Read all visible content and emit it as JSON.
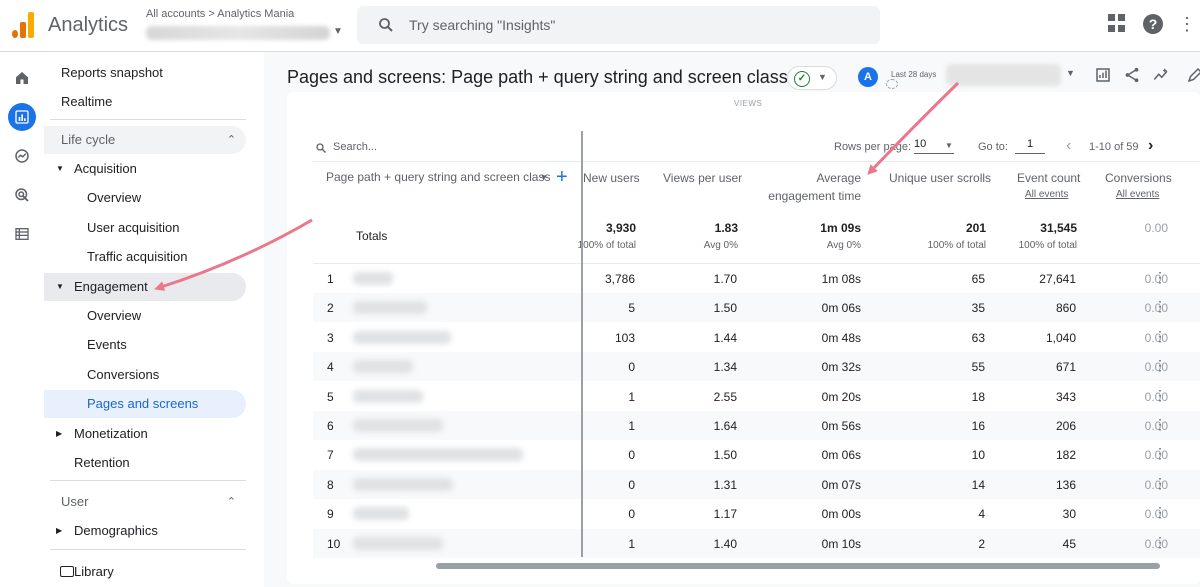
{
  "app": {
    "title": "Analytics",
    "account_breadcrumb": "All accounts > Analytics Mania",
    "search_placeholder": "Try searching \"Insights\""
  },
  "nav": {
    "reports_snapshot": "Reports snapshot",
    "realtime": "Realtime",
    "lifecycle_section": "Life cycle",
    "acquisition": "Acquisition",
    "acq_overview": "Overview",
    "user_acquisition": "User acquisition",
    "traffic_acquisition": "Traffic acquisition",
    "engagement": "Engagement",
    "eng_overview": "Overview",
    "events": "Events",
    "conversions": "Conversions",
    "pages_and_screens": "Pages and screens",
    "monetization": "Monetization",
    "retention": "Retention",
    "user_section": "User",
    "demographics": "Demographics",
    "library": "Library"
  },
  "header": {
    "page_title": "Pages and screens: Page path + query string and screen class",
    "compare_avatar": "A",
    "date_range_label": "Last 28 days"
  },
  "table": {
    "group_label": "VIEWS",
    "search_placeholder": "Search...",
    "rows_per_page_label": "Rows per page:",
    "rows_per_page_value": "10",
    "goto_label": "Go to:",
    "goto_value": "1",
    "range_label": "1-10 of 59",
    "dimension_header": "Page path + query string and screen class",
    "columns": {
      "new_users": "New users",
      "views_per_user": "Views per user",
      "avg_engagement_line1": "Average",
      "avg_engagement_line2": "engagement time",
      "unique_scrolls": "Unique user scrolls",
      "event_count": "Event count",
      "conversions": "Conversions"
    },
    "all_events_1": "All events",
    "all_events_2": "All events",
    "totals": {
      "label": "Totals",
      "new_users": "3,930",
      "new_users_sub": "100% of total",
      "views_per_user": "1.83",
      "views_per_user_sub": "Avg 0%",
      "avg_engagement": "1m 09s",
      "avg_engagement_sub": "Avg 0%",
      "unique_scrolls": "201",
      "unique_scrolls_sub": "100% of total",
      "event_count": "31,545",
      "event_count_sub": "100% of total",
      "conversions": "0.00"
    },
    "rows": [
      {
        "idx": "1",
        "new_users": "3,786",
        "views_per_user": "1.70",
        "avg_engagement": "1m 08s",
        "scrolls": "65",
        "events": "27,641",
        "conversions": "0.00"
      },
      {
        "idx": "2",
        "new_users": "5",
        "views_per_user": "1.50",
        "avg_engagement": "0m 06s",
        "scrolls": "35",
        "events": "860",
        "conversions": "0.00"
      },
      {
        "idx": "3",
        "new_users": "103",
        "views_per_user": "1.44",
        "avg_engagement": "0m 48s",
        "scrolls": "63",
        "events": "1,040",
        "conversions": "0.00"
      },
      {
        "idx": "4",
        "new_users": "0",
        "views_per_user": "1.34",
        "avg_engagement": "0m 32s",
        "scrolls": "55",
        "events": "671",
        "conversions": "0.00"
      },
      {
        "idx": "5",
        "new_users": "1",
        "views_per_user": "2.55",
        "avg_engagement": "0m 20s",
        "scrolls": "18",
        "events": "343",
        "conversions": "0.00"
      },
      {
        "idx": "6",
        "new_users": "1",
        "views_per_user": "1.64",
        "avg_engagement": "0m 56s",
        "scrolls": "16",
        "events": "206",
        "conversions": "0.00"
      },
      {
        "idx": "7",
        "new_users": "0",
        "views_per_user": "1.50",
        "avg_engagement": "0m 06s",
        "scrolls": "10",
        "events": "182",
        "conversions": "0.00"
      },
      {
        "idx": "8",
        "new_users": "0",
        "views_per_user": "1.31",
        "avg_engagement": "0m 07s",
        "scrolls": "14",
        "events": "136",
        "conversions": "0.00"
      },
      {
        "idx": "9",
        "new_users": "0",
        "views_per_user": "1.17",
        "avg_engagement": "0m 00s",
        "scrolls": "4",
        "events": "30",
        "conversions": "0.00"
      },
      {
        "idx": "10",
        "new_users": "1",
        "views_per_user": "1.40",
        "avg_engagement": "0m 10s",
        "scrolls": "2",
        "events": "45",
        "conversions": "0.00"
      }
    ]
  },
  "colors": {
    "accent": "#1a73e8",
    "annotation_arrow": "#e8788a",
    "selected_nav_bg": "#e8f0fe"
  }
}
